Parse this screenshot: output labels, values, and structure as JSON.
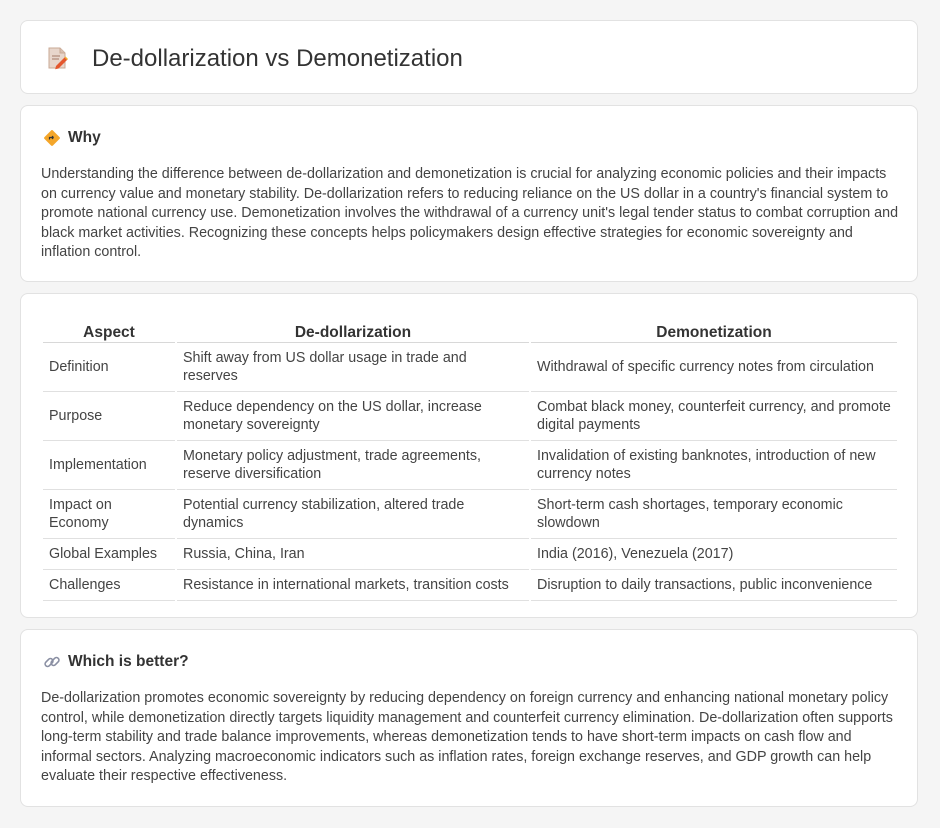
{
  "header": {
    "title": "De-dollarization vs Demonetization",
    "icon": "document-pencil-icon"
  },
  "why": {
    "icon": "diamond-sign-icon",
    "title": "Why",
    "body": "Understanding the difference between de-dollarization and demonetization is crucial for analyzing economic policies and their impacts on currency value and monetary stability. De-dollarization refers to reducing reliance on the US dollar in a country's financial system to promote national currency use. Demonetization involves the withdrawal of a currency unit's legal tender status to combat corruption and black market activities. Recognizing these concepts helps policymakers design effective strategies for economic sovereignty and inflation control."
  },
  "table": {
    "headers": [
      "Aspect",
      "De-dollarization",
      "Demonetization"
    ],
    "rows": [
      [
        "Definition",
        "Shift away from US dollar usage in trade and reserves",
        "Withdrawal of specific currency notes from circulation"
      ],
      [
        "Purpose",
        "Reduce dependency on the US dollar, increase monetary sovereignty",
        "Combat black money, counterfeit currency, and promote digital payments"
      ],
      [
        "Implementation",
        "Monetary policy adjustment, trade agreements, reserve diversification",
        "Invalidation of existing banknotes, introduction of new currency notes"
      ],
      [
        "Impact on Economy",
        "Potential currency stabilization, altered trade dynamics",
        "Short-term cash shortages, temporary economic slowdown"
      ],
      [
        "Global Examples",
        "Russia, China, Iran",
        "India (2016), Venezuela (2017)"
      ],
      [
        "Challenges",
        "Resistance in international markets, transition costs",
        "Disruption to daily transactions, public inconvenience"
      ]
    ]
  },
  "which": {
    "icon": "link-icon",
    "title": "Which is better?",
    "body": "De-dollarization promotes economic sovereignty by reducing dependency on foreign currency and enhancing national monetary policy control, while demonetization directly targets liquidity management and counterfeit currency elimination. De-dollarization often supports long-term stability and trade balance improvements, whereas demonetization tends to have short-term impacts on cash flow and informal sectors. Analyzing macroeconomic indicators such as inflation rates, foreign exchange reserves, and GDP growth can help evaluate their respective effectiveness."
  }
}
